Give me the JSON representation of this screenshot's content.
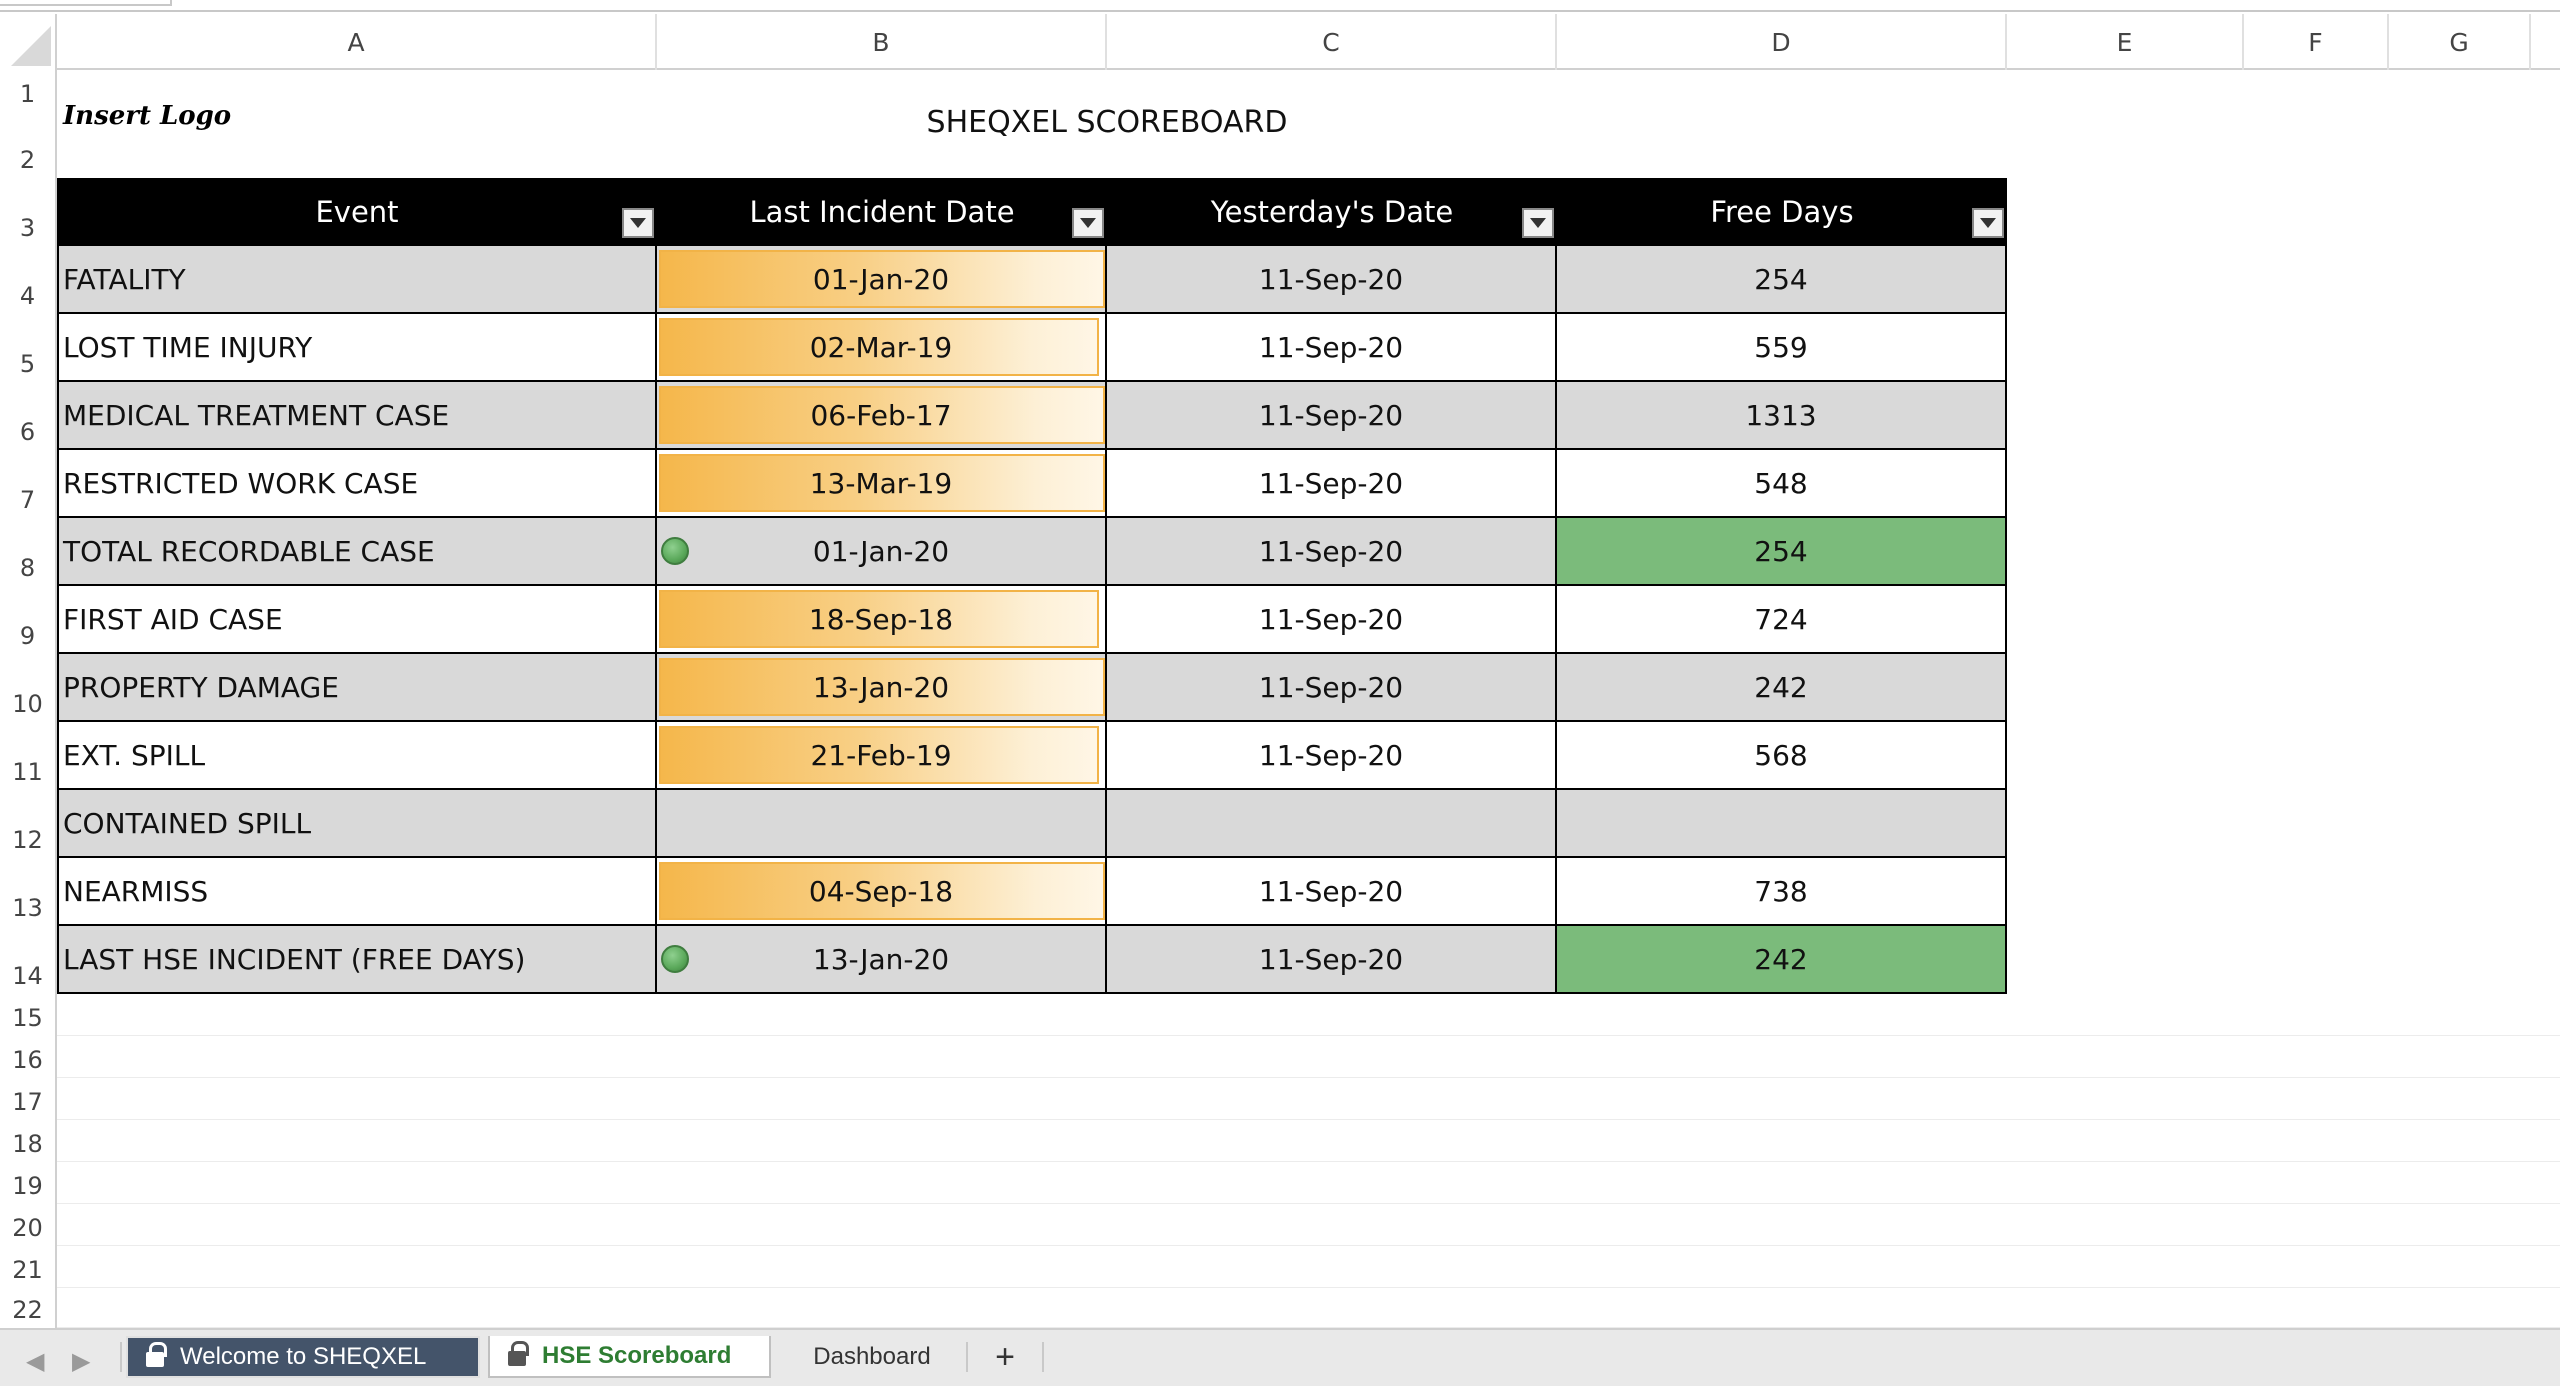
{
  "columns": [
    "A",
    "B",
    "C",
    "D",
    "E",
    "F",
    "G"
  ],
  "rows": [
    "1",
    "2",
    "3",
    "4",
    "5",
    "6",
    "7",
    "8",
    "9",
    "10",
    "11",
    "12",
    "13",
    "14",
    "15",
    "16",
    "17",
    "18",
    "19",
    "20",
    "21",
    "22"
  ],
  "logo_text": "Insert Logo",
  "title": "SHEQXEL SCOREBOARD",
  "table": {
    "headers": [
      "Event",
      "Last Incident Date",
      "Yesterday's Date",
      "Free Days"
    ],
    "rows": [
      {
        "event": "FATALITY",
        "last": "01-Jan-20",
        "yesterday": "11-Sep-20",
        "free": "254"
      },
      {
        "event": "LOST TIME INJURY",
        "last": "02-Mar-19",
        "yesterday": "11-Sep-20",
        "free": "559"
      },
      {
        "event": "MEDICAL TREATMENT CASE",
        "last": "06-Feb-17",
        "yesterday": "11-Sep-20",
        "free": "1313"
      },
      {
        "event": "RESTRICTED WORK CASE",
        "last": "13-Mar-19",
        "yesterday": "11-Sep-20",
        "free": "548"
      },
      {
        "event": "TOTAL RECORDABLE CASE",
        "last": "01-Jan-20",
        "yesterday": "11-Sep-20",
        "free": "254"
      },
      {
        "event": "FIRST AID CASE",
        "last": "18-Sep-18",
        "yesterday": "11-Sep-20",
        "free": "724"
      },
      {
        "event": "PROPERTY DAMAGE",
        "last": "13-Jan-20",
        "yesterday": "11-Sep-20",
        "free": "242"
      },
      {
        "event": "EXT. SPILL",
        "last": "21-Feb-19",
        "yesterday": "11-Sep-20",
        "free": "568"
      },
      {
        "event": "CONTAINED SPILL",
        "last": "",
        "yesterday": "",
        "free": ""
      },
      {
        "event": "NEARMISS",
        "last": "04-Sep-18",
        "yesterday": "11-Sep-20",
        "free": "738"
      },
      {
        "event": "LAST HSE INCIDENT (FREE DAYS)",
        "last": "13-Jan-20",
        "yesterday": "11-Sep-20",
        "free": "242"
      }
    ]
  },
  "tabs": {
    "tab1": "Welcome to SHEQXEL",
    "tab2": "HSE Scoreboard",
    "tab3": "Dashboard",
    "add": "+"
  },
  "colors": {
    "header_bg": "#000000",
    "shade_row": "#d9d9d9",
    "highlight_green": "#7bbb7b",
    "databar_orange": "#f5b74b",
    "active_tab_text": "#2e7d32",
    "locked_tab_bg": "#44546a"
  },
  "icons": [
    "lock-icon",
    "filter-dropdown-icon",
    "green-status-icon",
    "scroll-left-icon",
    "scroll-right-icon",
    "add-sheet-icon"
  ]
}
